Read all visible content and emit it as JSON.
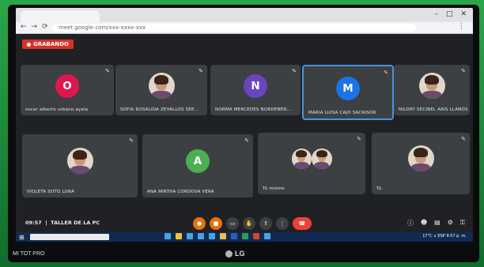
{
  "recording": {
    "label": "GRABANDO"
  },
  "browser": {
    "url": "meet.google.com/xxx-xxxx-xxx"
  },
  "participants": [
    {
      "name": "oscar alberto urbano ayala",
      "initial": "O",
      "color": "#e0174f",
      "type": "initial",
      "case": "lower"
    },
    {
      "name": "SOFIA ROSALIDA ZEVALLOS SEE...",
      "type": "photo",
      "case": "upper"
    },
    {
      "name": "NORMA MERCEDES NORDENER...",
      "initial": "N",
      "color": "#6a45c2",
      "type": "initial",
      "case": "upper"
    },
    {
      "name": "MARIA LUISA CAJO SACRISOR",
      "initial": "M",
      "color": "#1a73e8",
      "type": "initial",
      "case": "upper",
      "active": true
    },
    {
      "name": "NILDRY SECIBEL ARIS LLANOS",
      "type": "photo",
      "case": "upper"
    },
    {
      "name": "VIOLETA SOTO LUNA",
      "type": "photo",
      "case": "upper"
    },
    {
      "name": "ANA MIRTHA CORDOVA VERA",
      "initial": "A",
      "color": "#4caf50",
      "type": "initial",
      "case": "upper"
    },
    {
      "name": "Tú mismo",
      "type": "photo-pair",
      "case": "lower"
    },
    {
      "name": "Tú",
      "type": "photo",
      "case": "lower"
    }
  ],
  "meeting": {
    "time": "09:57",
    "title": "TALLER DE LA PC"
  },
  "taskbar": {
    "tray": "17°C  ∧  ESP  9:57 p. m."
  },
  "device": {
    "brand": "LG"
  },
  "watermark": {
    "text": "MI TOT PRO"
  },
  "icons": {
    "pin": "pin-icon",
    "mic": "microphone-icon",
    "camera": "camera-icon",
    "captions": "captions-icon",
    "hand": "raise-hand-icon",
    "present": "present-screen-icon",
    "more": "more-options-icon",
    "end": "end-call-icon"
  }
}
